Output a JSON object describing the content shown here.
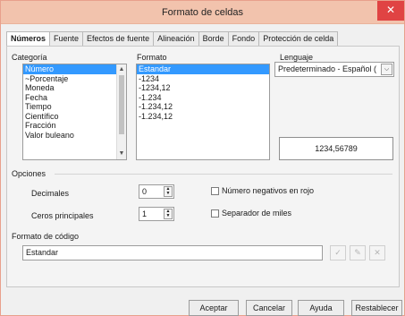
{
  "window": {
    "title": "Formato de celdas",
    "close_symbol": "✕"
  },
  "tabs": [
    {
      "label": "Números",
      "active": true
    },
    {
      "label": "Fuente"
    },
    {
      "label": "Efectos de fuente"
    },
    {
      "label": "Alineación"
    },
    {
      "label": "Borde"
    },
    {
      "label": "Fondo"
    },
    {
      "label": "Protección de celda"
    }
  ],
  "category": {
    "label": "Categoría",
    "items": [
      "Número",
      "~Porcentaje",
      "Moneda",
      "Fecha",
      "Tiempo",
      "Científico",
      "Fracción",
      "Valor buleano"
    ],
    "selected_index": 0
  },
  "format": {
    "label": "Formato",
    "items": [
      "Estandar",
      "-1234",
      "-1234,12",
      "-1.234",
      "-1.234,12",
      "-1.234,12"
    ],
    "selected_index": 0
  },
  "language": {
    "label": "Lenguaje",
    "value": "Predeterminado - Español ("
  },
  "preview": {
    "value": "1234,56789"
  },
  "options": {
    "label": "Opciones",
    "decimals_label": "Decimales",
    "decimals_value": "0",
    "leading_zeros_label": "Ceros principales",
    "leading_zeros_value": "1",
    "negative_red_label": "Número negativos en rojo",
    "thousands_sep_label": "Separador de miles"
  },
  "format_code": {
    "label": "Formato de código",
    "value": "Estandar"
  },
  "buttons": {
    "accept": "Aceptar",
    "cancel": "Cancelar",
    "help": "Ayuda",
    "reset": "Restablecer"
  },
  "icons": {
    "check": "✓",
    "edit": "✎",
    "delete": "✕",
    "up": "▲",
    "down": "▼",
    "combo_arrow": "⌵"
  }
}
